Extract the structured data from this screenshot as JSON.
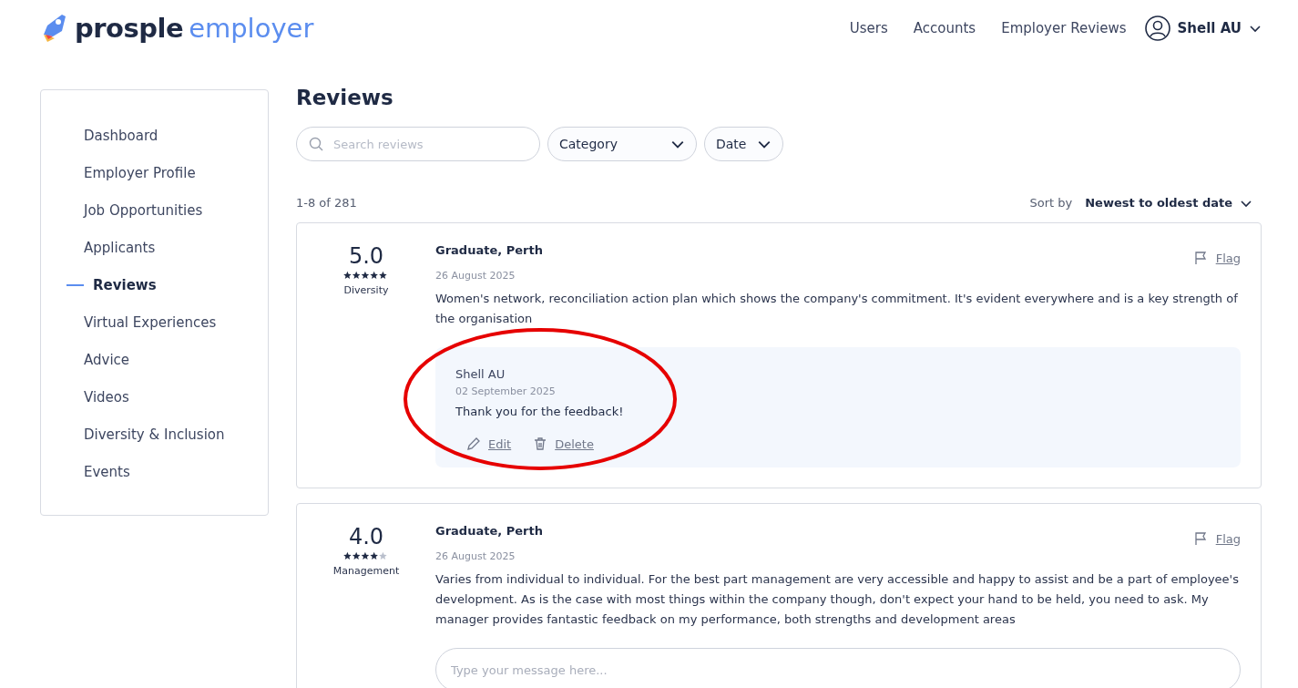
{
  "header": {
    "logo": {
      "brand": "prosple",
      "product": "employer"
    },
    "nav": [
      "Users",
      "Accounts",
      "Employer Reviews"
    ],
    "account": {
      "name": "Shell AU"
    }
  },
  "sidebar": {
    "items": [
      {
        "label": "Dashboard",
        "selected": false
      },
      {
        "label": "Employer Profile",
        "selected": false
      },
      {
        "label": "Job Opportunities",
        "selected": false
      },
      {
        "label": "Applicants",
        "selected": false
      },
      {
        "label": "Reviews",
        "selected": true
      },
      {
        "label": "Virtual Experiences",
        "selected": false
      },
      {
        "label": "Advice",
        "selected": false
      },
      {
        "label": "Videos",
        "selected": false
      },
      {
        "label": "Diversity & Inclusion",
        "selected": false
      },
      {
        "label": "Events",
        "selected": false
      }
    ]
  },
  "page": {
    "title": "Reviews",
    "search": {
      "placeholder": "Search reviews"
    },
    "filters": [
      "Category",
      "Date"
    ],
    "count": "1-8 of 281",
    "sort": {
      "label": "Sort by",
      "value": "Newest to oldest date"
    }
  },
  "reviews": [
    {
      "score": "5.0",
      "stars": 5,
      "category": "Diversity",
      "author": "Graduate, Perth",
      "date": "26 August 2025",
      "text": "Women's network, reconciliation action plan which shows the company's commitment. It's evident everywhere and is a key strength of the organisation",
      "flag": "Flag",
      "reply": {
        "author": "Shell AU",
        "date": "02 September 2025",
        "text": "Thank you for the feedback!",
        "actions": [
          "Edit",
          "Delete"
        ],
        "annotated": true
      }
    },
    {
      "score": "4.0",
      "stars": 4,
      "category": "Management",
      "author": "Graduate, Perth",
      "date": "26 August 2025",
      "text": "Varies from individual to individual. For the best part management are very accessible and happy to assist and be a part of employee's development. As is the case with most things within the company though, don't expect your hand to be held, you need to ask. My manager provides fantastic feedback on my performance, both strengths and development areas",
      "flag": "Flag",
      "message": {
        "placeholder": "Type your message here..."
      }
    }
  ]
}
